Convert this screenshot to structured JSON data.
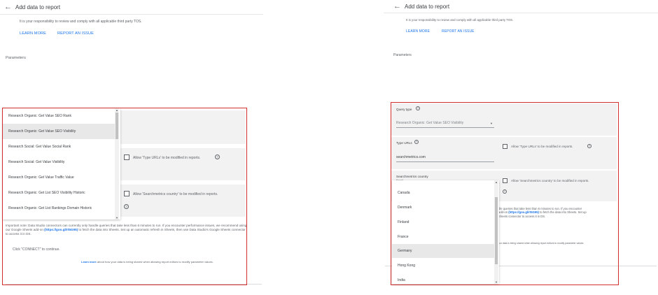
{
  "header": {
    "title": "Add data to report"
  },
  "notice": {
    "tos_text": "It is your responsibility to review and comply with all applicable third party TOS.",
    "learn_more": "LEARN MORE",
    "report_issue": "REPORT AN ISSUE"
  },
  "parameters_label": "Parameters",
  "left_dropdown": {
    "options": [
      "Research Organic: Get Value SEO Rank",
      "Research Organic: Get Value SEO Visibility",
      "Research Social: Get Value Social Rank",
      "Research Social: Get Value Visibility",
      "Research Organic: Get Value Traffic Value",
      "Research Organic: Get List SEO Visibility Historic",
      "Research Organic: Get List Rankings Domain Historic"
    ],
    "selected_index": 1
  },
  "allow_type_urls": "Allow 'Type URLs' to be modified in reports.",
  "allow_country": "Allow 'Searchmetrics country' to be modified in reports.",
  "note_parts": {
    "pre": "Important note: Data Studio connectors can currently only handle queries that take less than 6 minutes to run. If you encounter performance issues, we recommend using our Google Sheets add-on ",
    "link": "(https://goo.gl/rt5G95)",
    "post": " to fetch the data into Sheets. Set up an automatic refresh in Sheets, then use Data Studio's Google Sheets connector to access it in DS."
  },
  "note_right_parts": {
    "l1": "dle queries that take less than 6 minutes to run. If you encounter",
    "l2a": "add-on ",
    "l2link": "(https://goo.gl/rt5G95)",
    "l2b": " to fetch the data into Sheets. Set up",
    "l3": "Sheets connector to access it in DS."
  },
  "connect_hint": "Click \"CONNECT\" to continue.",
  "learn_more_small": {
    "link": "Learn more",
    "text": " about how your data is being shared when allowing report editors to modify parameter values."
  },
  "learn_more_small_right": "our data is being shared when allowing report editors to modify parameter values.",
  "right_form": {
    "query_type_label": "Query type",
    "query_type_value": "Research Organic: Get Value SEO Visibility",
    "type_urls_label": "Type URLs",
    "type_urls_value": "searchmetrics.com",
    "country_label": "Searchmetrics country",
    "country_partial": "Brazil"
  },
  "right_dropdown": {
    "options": [
      "Canada",
      "Denmark",
      "Finland",
      "France",
      "Germany",
      "Hong Kong",
      "India"
    ],
    "selected_index": 4
  },
  "help_glyph": "?",
  "arrow_glyph": "←",
  "up_glyph": "▲",
  "down_glyph": "▼",
  "colors": {
    "accent": "#1a73e8",
    "highlight_border": "#d32f2f",
    "selected_row": "#e8e8e8",
    "field_bg": "#f2f2f2"
  }
}
